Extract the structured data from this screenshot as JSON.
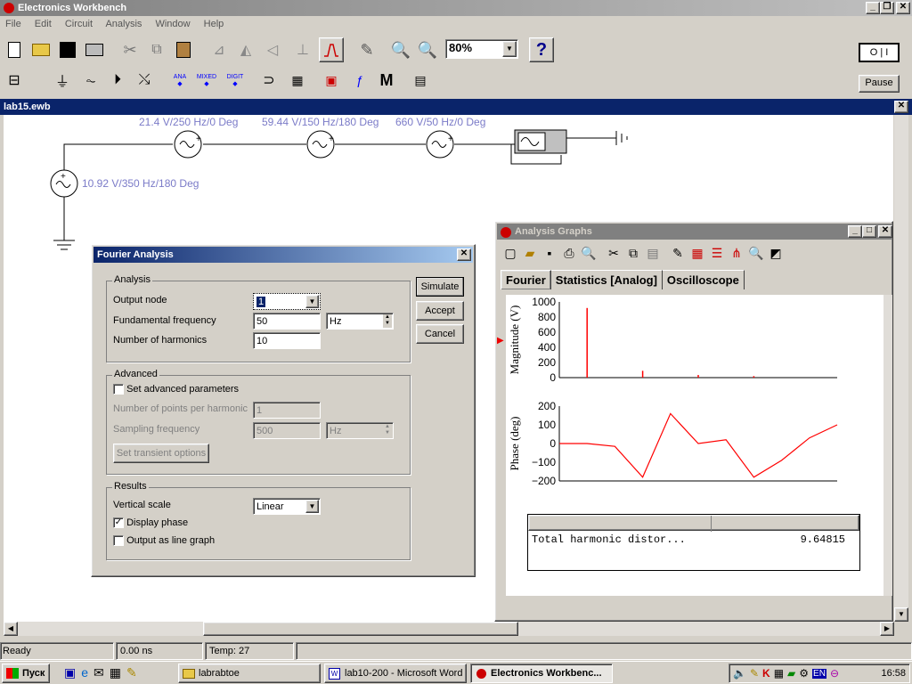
{
  "app": {
    "title": "Electronics Workbench"
  },
  "menu": [
    "File",
    "Edit",
    "Circuit",
    "Analysis",
    "Window",
    "Help"
  ],
  "zoom": "80%",
  "help_label": "?",
  "pause_label": "Pause",
  "toolbar2": {
    "ana": "ANA",
    "mixed": "MIXED",
    "digit": "DIGIT",
    "m": "M"
  },
  "doc": {
    "title": "lab15.ewb"
  },
  "sources": [
    {
      "label": "21.4 V/250 Hz/0 Deg"
    },
    {
      "label": "59.44 V/150 Hz/180 Deg"
    },
    {
      "label": "660 V/50 Hz/0 Deg"
    },
    {
      "label": "10.92 V/350 Hz/180 Deg"
    }
  ],
  "fourier": {
    "title": "Fourier Analysis",
    "analysis_group": "Analysis",
    "output_node_label": "Output node",
    "output_node_value": "1",
    "fund_freq_label": "Fundamental frequency",
    "fund_freq_value": "50",
    "fund_freq_unit": "Hz",
    "harmonics_label": "Number of harmonics",
    "harmonics_value": "10",
    "advanced_group": "Advanced",
    "set_adv_label": "Set advanced parameters",
    "points_label": "Number of points per harmonic",
    "points_value": "1",
    "sampling_label": "Sampling frequency",
    "sampling_value": "500",
    "sampling_unit": "Hz",
    "transient_btn": "Set transient options",
    "results_group": "Results",
    "vscale_label": "Vertical scale",
    "vscale_value": "Linear",
    "display_phase_label": "Display phase",
    "display_phase_checked": true,
    "line_graph_label": "Output as line graph",
    "line_graph_checked": false,
    "simulate": "Simulate",
    "accept": "Accept",
    "cancel": "Cancel"
  },
  "graphs": {
    "title": "Analysis Graphs",
    "tabs": [
      "Fourier",
      "Statistics [Analog]",
      "Oscilloscope"
    ],
    "thd_label": "Total harmonic distor...",
    "thd_value": "9.64815"
  },
  "chart_data": [
    {
      "type": "bar",
      "ylabel": "Magnitude (V)",
      "yticks": [
        "1000",
        "800",
        "600",
        "400",
        "200",
        "0"
      ],
      "ylim": [
        0,
        1000
      ],
      "x": [
        50,
        150,
        250,
        350
      ],
      "values": [
        920,
        90,
        35,
        20
      ],
      "color": "#ff0000"
    },
    {
      "type": "line",
      "ylabel": "Phase (deg)",
      "yticks": [
        "200",
        "100",
        "0",
        "−100",
        "−200"
      ],
      "ylim": [
        -200,
        200
      ],
      "x": [
        0,
        1,
        2,
        3,
        4,
        5,
        6,
        7,
        8,
        9
      ],
      "values": [
        0,
        0,
        -15,
        -180,
        160,
        0,
        20,
        -180,
        -90,
        30,
        100
      ],
      "color": "#ff0000"
    }
  ],
  "status": {
    "ready": "Ready",
    "time": "0.00 ns",
    "temp": "Temp:  27"
  },
  "taskbar": {
    "start": "Пуск",
    "tasks": [
      "labrabtoe",
      "lab10-200 - Microsoft Word",
      "Electronics Workbenc..."
    ],
    "lang": "EN",
    "clock": "16:58"
  },
  "colors": {
    "title_active": "#0a246a",
    "title_inactive": "#808080",
    "circuit_label": "#7b7bc8",
    "plot": "#ff0000"
  }
}
